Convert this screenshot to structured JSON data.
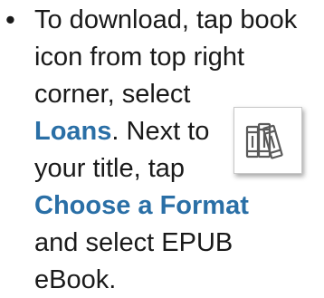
{
  "bullet": "•",
  "lines": [
    {
      "segments": [
        {
          "text": "To download, tap book"
        }
      ]
    },
    {
      "segments": [
        {
          "text": "icon from top right"
        }
      ]
    },
    {
      "segments": [
        {
          "text": "corner, select"
        }
      ]
    },
    {
      "segments": [
        {
          "text": "Loans",
          "emphasis": true
        },
        {
          "text": ". Next to"
        }
      ]
    },
    {
      "segments": [
        {
          "text": "your title, tap"
        }
      ]
    },
    {
      "segments": [
        {
          "text": "Choose a Format",
          "emphasis": true
        }
      ]
    },
    {
      "segments": [
        {
          "text": "and select EPUB"
        }
      ]
    },
    {
      "segments": [
        {
          "text": "eBook."
        }
      ]
    }
  ],
  "icon": {
    "name": "books-icon"
  },
  "colors": {
    "emphasis": "#2a6fa6",
    "text": "#1a1a1a"
  }
}
